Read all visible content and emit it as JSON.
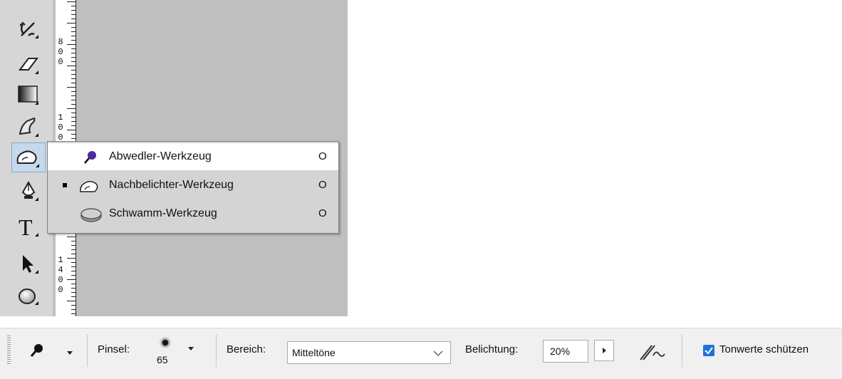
{
  "toolbox": {
    "tools": [
      {
        "name": "history-brush-icon"
      },
      {
        "name": "eraser-icon"
      },
      {
        "name": "gradient-icon"
      },
      {
        "name": "smudge-icon"
      },
      {
        "name": "burn-icon"
      },
      {
        "name": "pen-icon"
      },
      {
        "name": "type-icon"
      },
      {
        "name": "selection-arrow-icon"
      },
      {
        "name": "ellipse-icon"
      }
    ]
  },
  "ruler": {
    "labels": [
      "8",
      "0",
      "0",
      "1",
      "0",
      "0",
      "1",
      "4",
      "0",
      "0"
    ]
  },
  "flyout": {
    "items": [
      {
        "label": "Abwedler-Werkzeug",
        "shortcut": "O",
        "icon": "dodge-icon",
        "highlighted": true,
        "active": false
      },
      {
        "label": "Nachbelichter-Werkzeug",
        "shortcut": "O",
        "icon": "burn-icon",
        "highlighted": false,
        "active": true
      },
      {
        "label": "Schwamm-Werkzeug",
        "shortcut": "O",
        "icon": "sponge-icon",
        "highlighted": false,
        "active": false
      }
    ]
  },
  "optionsbar": {
    "pinsel_label": "Pinsel:",
    "brush_size": "65",
    "bereich_label": "Bereich:",
    "bereich_value": "Mitteltöne",
    "belichtung_label": "Belichtung:",
    "belichtung_value": "20%",
    "tonwerte_label": "Tonwerte schützen",
    "tonwerte_checked": true
  },
  "colors": {
    "highlight": "#ffffff",
    "menu_bg": "#d4d4d4",
    "checkbox": "#1e73d8",
    "dodge_icon": "#4b2c9e"
  }
}
